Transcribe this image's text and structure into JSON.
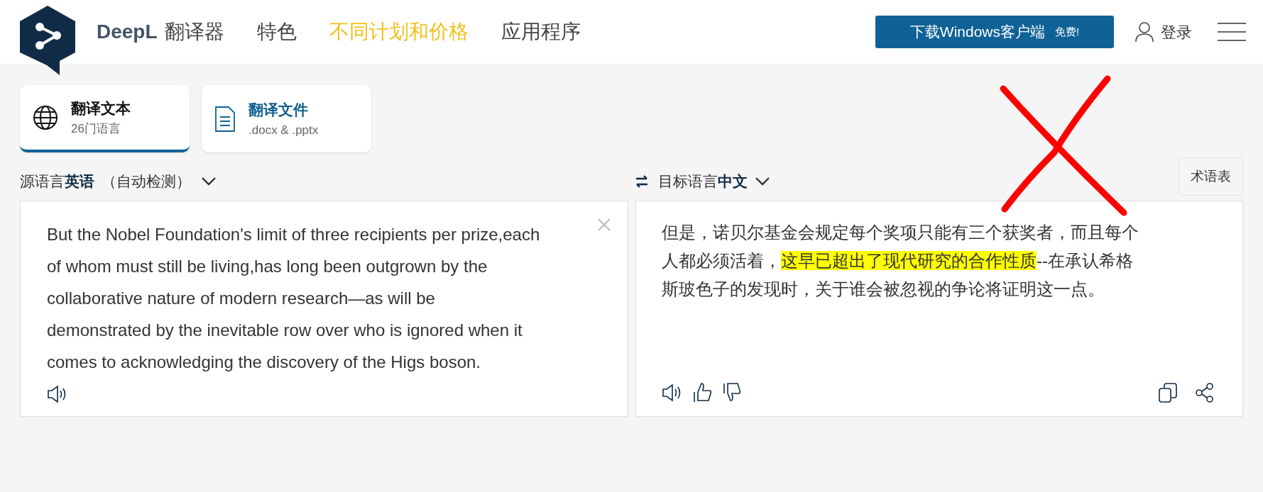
{
  "header": {
    "brand": "DeepL",
    "product": "翻译器",
    "nav": [
      {
        "label": "特色",
        "selected": false
      },
      {
        "label": "不同计划和价格",
        "selected": true
      },
      {
        "label": "应用程序",
        "selected": false
      }
    ],
    "download_button": {
      "label": "下载Windows客户端",
      "badge": "免费!"
    },
    "login": "登录"
  },
  "modes": [
    {
      "kind": "text",
      "title": "翻译文本",
      "subtitle": "26门语言",
      "selected": true
    },
    {
      "kind": "file",
      "title": "翻译文件",
      "subtitle": ".docx & .pptx",
      "selected": false
    }
  ],
  "source": {
    "prefix": "源语言",
    "language": "英语",
    "detect": "（自动检测）",
    "text": "But the Nobel Foundation's limit of three recipients per prize,each of whom must still be living,has long been outgrown by the collaborative nature of modern research—as will be demonstrated by the inevitable row over who is ignored when it comes to acknowledging the discovery of the Higs boson."
  },
  "target": {
    "prefix": "目标语言",
    "language": "中文",
    "glossary_button": "术语表",
    "segments": [
      {
        "text": "但是，诺贝尔基金会规定每个奖项只能有三个获奖者，而且每个人都必须活着，",
        "highlighted": false
      },
      {
        "text": "这早已超出了现代研究的合作性质",
        "highlighted": true
      },
      {
        "text": "--在承认希格斯玻色子的发现时，关于谁会被忽视的争论将证明这一点。",
        "highlighted": false
      }
    ]
  },
  "annotation": {
    "kind": "cross"
  }
}
